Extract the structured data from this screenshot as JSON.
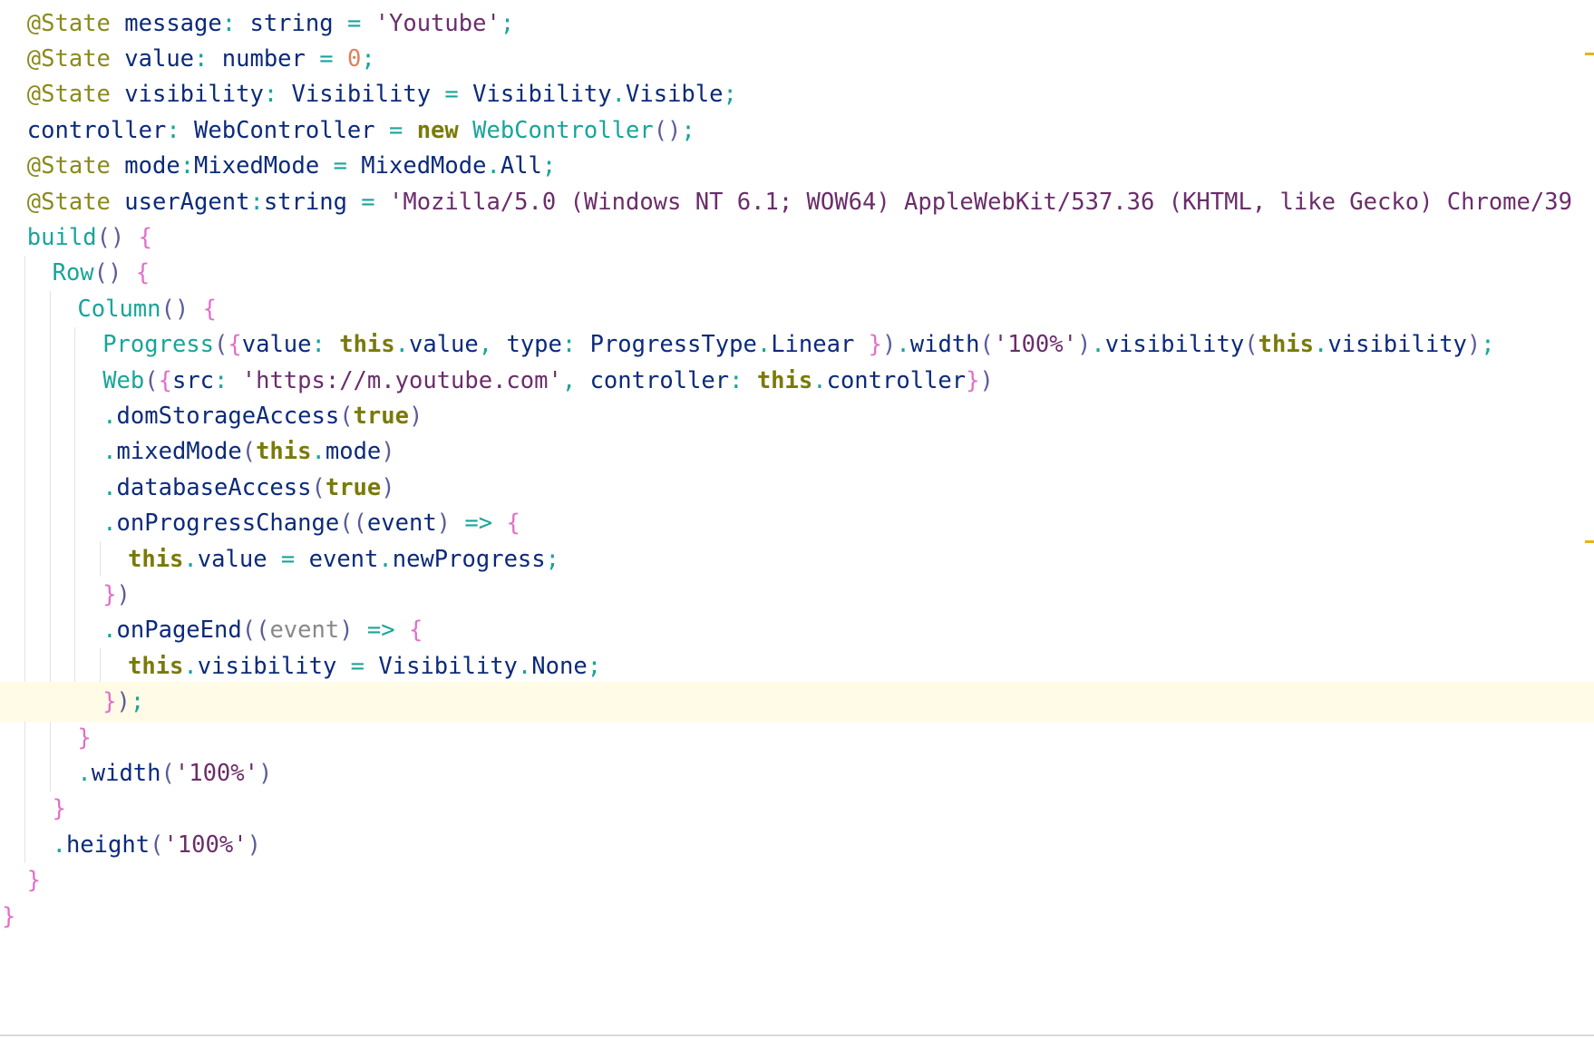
{
  "colors": {
    "background": "#ffffff",
    "current_line": "#fffbe6",
    "annotation": "#8a8a1c",
    "identifier": "#0b2a7a",
    "keyword": "#7a7a0a",
    "component": "#18a599",
    "string": "#6b2d6b",
    "number": "#e08060",
    "brace": "#e070c8",
    "paren": "#5b5b9b",
    "punct": "#18a599",
    "gray": "#888888",
    "indent_guide": "#e3e3e3",
    "scroll_marker": "#e5b418"
  },
  "lines": [
    {
      "indent": 1,
      "tokens": [
        {
          "t": "@State",
          "c": "annotation"
        },
        {
          "t": " message",
          "c": "identifier"
        },
        {
          "t": ":",
          "c": "punct"
        },
        {
          "t": " string ",
          "c": "identifier"
        },
        {
          "t": "=",
          "c": "punct"
        },
        {
          "t": " 'Youtube'",
          "c": "string"
        },
        {
          "t": ";",
          "c": "punct"
        }
      ]
    },
    {
      "indent": 1,
      "tokens": [
        {
          "t": "@State",
          "c": "annotation"
        },
        {
          "t": " value",
          "c": "identifier"
        },
        {
          "t": ":",
          "c": "punct"
        },
        {
          "t": " number ",
          "c": "identifier"
        },
        {
          "t": "=",
          "c": "punct"
        },
        {
          "t": " ",
          "c": "identifier"
        },
        {
          "t": "0",
          "c": "number"
        },
        {
          "t": ";",
          "c": "punct"
        }
      ]
    },
    {
      "indent": 1,
      "tokens": [
        {
          "t": "@State",
          "c": "annotation"
        },
        {
          "t": " visibility",
          "c": "identifier"
        },
        {
          "t": ":",
          "c": "punct"
        },
        {
          "t": " Visibility ",
          "c": "identifier"
        },
        {
          "t": "=",
          "c": "punct"
        },
        {
          "t": " Visibility",
          "c": "identifier"
        },
        {
          "t": ".",
          "c": "punct"
        },
        {
          "t": "Visible",
          "c": "identifier"
        },
        {
          "t": ";",
          "c": "punct"
        }
      ]
    },
    {
      "indent": 1,
      "tokens": [
        {
          "t": "controller",
          "c": "identifier"
        },
        {
          "t": ":",
          "c": "punct"
        },
        {
          "t": " WebController ",
          "c": "identifier"
        },
        {
          "t": "=",
          "c": "punct"
        },
        {
          "t": " new",
          "c": "keyword"
        },
        {
          "t": " WebController",
          "c": "component"
        },
        {
          "t": "()",
          "c": "paren"
        },
        {
          "t": ";",
          "c": "punct"
        }
      ]
    },
    {
      "indent": 1,
      "tokens": [
        {
          "t": "@State",
          "c": "annotation"
        },
        {
          "t": " mode",
          "c": "identifier"
        },
        {
          "t": ":",
          "c": "punct"
        },
        {
          "t": "MixedMode ",
          "c": "identifier"
        },
        {
          "t": "=",
          "c": "punct"
        },
        {
          "t": " MixedMode",
          "c": "identifier"
        },
        {
          "t": ".",
          "c": "punct"
        },
        {
          "t": "All",
          "c": "identifier"
        },
        {
          "t": ";",
          "c": "punct"
        }
      ]
    },
    {
      "indent": 1,
      "tokens": [
        {
          "t": "@State",
          "c": "annotation"
        },
        {
          "t": " userAgent",
          "c": "identifier"
        },
        {
          "t": ":",
          "c": "punct"
        },
        {
          "t": "string ",
          "c": "identifier"
        },
        {
          "t": "=",
          "c": "punct"
        },
        {
          "t": " 'Mozilla/5.0 (Windows NT 6.1; WOW64) AppleWebKit/537.36 (",
          "c": "string"
        },
        {
          "t": "KHTML",
          "c": "string",
          "squiggle": true
        },
        {
          "t": ", like Gecko) Chrome/39",
          "c": "string"
        }
      ]
    },
    {
      "indent": 1,
      "tokens": [
        {
          "t": "build",
          "c": "component"
        },
        {
          "t": "()",
          "c": "paren"
        },
        {
          "t": " {",
          "c": "brace"
        }
      ]
    },
    {
      "indent": 2,
      "tokens": [
        {
          "t": "Row",
          "c": "component"
        },
        {
          "t": "()",
          "c": "paren"
        },
        {
          "t": " {",
          "c": "brace"
        }
      ]
    },
    {
      "indent": 3,
      "tokens": [
        {
          "t": "Column",
          "c": "component"
        },
        {
          "t": "()",
          "c": "paren"
        },
        {
          "t": " {",
          "c": "brace"
        }
      ]
    },
    {
      "indent": 4,
      "tokens": [
        {
          "t": "Progress",
          "c": "component"
        },
        {
          "t": "(",
          "c": "paren"
        },
        {
          "t": "{",
          "c": "brace"
        },
        {
          "t": "value",
          "c": "identifier"
        },
        {
          "t": ":",
          "c": "punct"
        },
        {
          "t": " this",
          "c": "keyword"
        },
        {
          "t": ".",
          "c": "punct"
        },
        {
          "t": "value",
          "c": "identifier"
        },
        {
          "t": ",",
          "c": "punct"
        },
        {
          "t": " type",
          "c": "identifier"
        },
        {
          "t": ":",
          "c": "punct"
        },
        {
          "t": " ProgressType",
          "c": "identifier"
        },
        {
          "t": ".",
          "c": "punct"
        },
        {
          "t": "Linear ",
          "c": "identifier"
        },
        {
          "t": "}",
          "c": "brace"
        },
        {
          "t": ")",
          "c": "paren"
        },
        {
          "t": ".",
          "c": "punct"
        },
        {
          "t": "width",
          "c": "identifier"
        },
        {
          "t": "(",
          "c": "paren"
        },
        {
          "t": "'100%'",
          "c": "string"
        },
        {
          "t": ")",
          "c": "paren"
        },
        {
          "t": ".",
          "c": "punct"
        },
        {
          "t": "visibility",
          "c": "identifier"
        },
        {
          "t": "(",
          "c": "paren"
        },
        {
          "t": "this",
          "c": "keyword"
        },
        {
          "t": ".",
          "c": "punct"
        },
        {
          "t": "visibility",
          "c": "identifier"
        },
        {
          "t": ")",
          "c": "paren"
        },
        {
          "t": ";",
          "c": "punct"
        }
      ]
    },
    {
      "indent": 4,
      "tokens": [
        {
          "t": "Web",
          "c": "component"
        },
        {
          "t": "(",
          "c": "paren"
        },
        {
          "t": "{",
          "c": "brace"
        },
        {
          "t": "src",
          "c": "identifier"
        },
        {
          "t": ":",
          "c": "punct"
        },
        {
          "t": " 'https://m.youtube.com'",
          "c": "string"
        },
        {
          "t": ",",
          "c": "punct"
        },
        {
          "t": " controller",
          "c": "identifier"
        },
        {
          "t": ":",
          "c": "punct"
        },
        {
          "t": " this",
          "c": "keyword"
        },
        {
          "t": ".",
          "c": "punct"
        },
        {
          "t": "controller",
          "c": "identifier"
        },
        {
          "t": "}",
          "c": "brace"
        },
        {
          "t": ")",
          "c": "paren"
        }
      ]
    },
    {
      "indent": 4,
      "tokens": [
        {
          "t": ".",
          "c": "punct"
        },
        {
          "t": "domStorageAccess",
          "c": "identifier"
        },
        {
          "t": "(",
          "c": "paren"
        },
        {
          "t": "true",
          "c": "keyword"
        },
        {
          "t": ")",
          "c": "paren"
        }
      ]
    },
    {
      "indent": 4,
      "tokens": [
        {
          "t": ".",
          "c": "punct"
        },
        {
          "t": "mixedMode",
          "c": "identifier"
        },
        {
          "t": "(",
          "c": "paren"
        },
        {
          "t": "this",
          "c": "keyword"
        },
        {
          "t": ".",
          "c": "punct"
        },
        {
          "t": "mode",
          "c": "identifier"
        },
        {
          "t": ")",
          "c": "paren"
        }
      ]
    },
    {
      "indent": 4,
      "tokens": [
        {
          "t": ".",
          "c": "punct"
        },
        {
          "t": "databaseAccess",
          "c": "identifier"
        },
        {
          "t": "(",
          "c": "paren"
        },
        {
          "t": "true",
          "c": "keyword"
        },
        {
          "t": ")",
          "c": "paren"
        }
      ]
    },
    {
      "indent": 4,
      "tokens": [
        {
          "t": ".",
          "c": "punct"
        },
        {
          "t": "onProgressChange",
          "c": "identifier"
        },
        {
          "t": "((",
          "c": "paren"
        },
        {
          "t": "event",
          "c": "identifier"
        },
        {
          "t": ")",
          "c": "paren"
        },
        {
          "t": " =>",
          "c": "punct"
        },
        {
          "t": " {",
          "c": "brace"
        }
      ]
    },
    {
      "indent": 5,
      "tokens": [
        {
          "t": "this",
          "c": "keyword"
        },
        {
          "t": ".",
          "c": "punct"
        },
        {
          "t": "value ",
          "c": "identifier"
        },
        {
          "t": "=",
          "c": "punct"
        },
        {
          "t": " event",
          "c": "identifier"
        },
        {
          "t": ".",
          "c": "punct"
        },
        {
          "t": "newProgress",
          "c": "identifier"
        },
        {
          "t": ";",
          "c": "punct"
        }
      ]
    },
    {
      "indent": 4,
      "tokens": [
        {
          "t": "}",
          "c": "brace"
        },
        {
          "t": ")",
          "c": "paren"
        }
      ]
    },
    {
      "indent": 4,
      "tokens": [
        {
          "t": ".",
          "c": "punct"
        },
        {
          "t": "onPageEnd",
          "c": "identifier"
        },
        {
          "t": "((",
          "c": "paren"
        },
        {
          "t": "event",
          "c": "gray"
        },
        {
          "t": ")",
          "c": "paren"
        },
        {
          "t": " =>",
          "c": "punct"
        },
        {
          "t": " {",
          "c": "brace"
        }
      ]
    },
    {
      "indent": 5,
      "tokens": [
        {
          "t": "this",
          "c": "keyword"
        },
        {
          "t": ".",
          "c": "punct"
        },
        {
          "t": "visibility ",
          "c": "identifier"
        },
        {
          "t": "=",
          "c": "punct"
        },
        {
          "t": " Visibility",
          "c": "identifier"
        },
        {
          "t": ".",
          "c": "punct"
        },
        {
          "t": "None",
          "c": "identifier"
        },
        {
          "t": ";",
          "c": "punct"
        }
      ]
    },
    {
      "indent": 4,
      "current": true,
      "tokens": [
        {
          "t": "}",
          "c": "brace"
        },
        {
          "t": ")",
          "c": "paren"
        },
        {
          "t": ";",
          "c": "punct"
        }
      ]
    },
    {
      "indent": 3,
      "tokens": [
        {
          "t": "}",
          "c": "brace"
        }
      ]
    },
    {
      "indent": 3,
      "tokens": [
        {
          "t": ".",
          "c": "punct"
        },
        {
          "t": "width",
          "c": "identifier"
        },
        {
          "t": "(",
          "c": "paren"
        },
        {
          "t": "'100%'",
          "c": "string"
        },
        {
          "t": ")",
          "c": "paren"
        }
      ]
    },
    {
      "indent": 2,
      "tokens": [
        {
          "t": "}",
          "c": "brace"
        }
      ]
    },
    {
      "indent": 2,
      "tokens": [
        {
          "t": ".",
          "c": "punct"
        },
        {
          "t": "height",
          "c": "identifier"
        },
        {
          "t": "(",
          "c": "paren"
        },
        {
          "t": "'100%'",
          "c": "string"
        },
        {
          "t": ")",
          "c": "paren"
        }
      ]
    },
    {
      "indent": 1,
      "tokens": [
        {
          "t": "}",
          "c": "brace"
        }
      ]
    },
    {
      "indent": 0,
      "tokens": [
        {
          "t": "}",
          "c": "brace"
        }
      ]
    }
  ]
}
